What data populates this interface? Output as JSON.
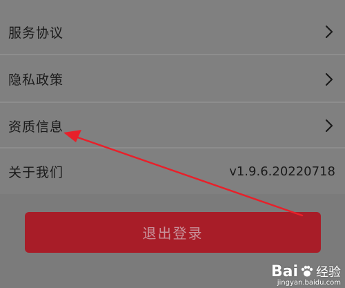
{
  "menu": {
    "items": [
      {
        "label": "服务协议",
        "has_chevron": true
      },
      {
        "label": "隐私政策",
        "has_chevron": true
      },
      {
        "label": "资质信息",
        "has_chevron": true
      },
      {
        "label": "关于我们",
        "value": "v1.9.6.20220718"
      }
    ]
  },
  "logout": {
    "label": "退出登录"
  },
  "colors": {
    "background": "#808080",
    "logout_button": "#a81d28",
    "logout_text": "#c8919a",
    "annotation_arrow": "#e8202a"
  },
  "icons": {
    "chevron": "chevron-right-icon"
  },
  "watermark": {
    "logo": "Bai",
    "brand": "经验",
    "url": "jingyan.baidu.com"
  }
}
